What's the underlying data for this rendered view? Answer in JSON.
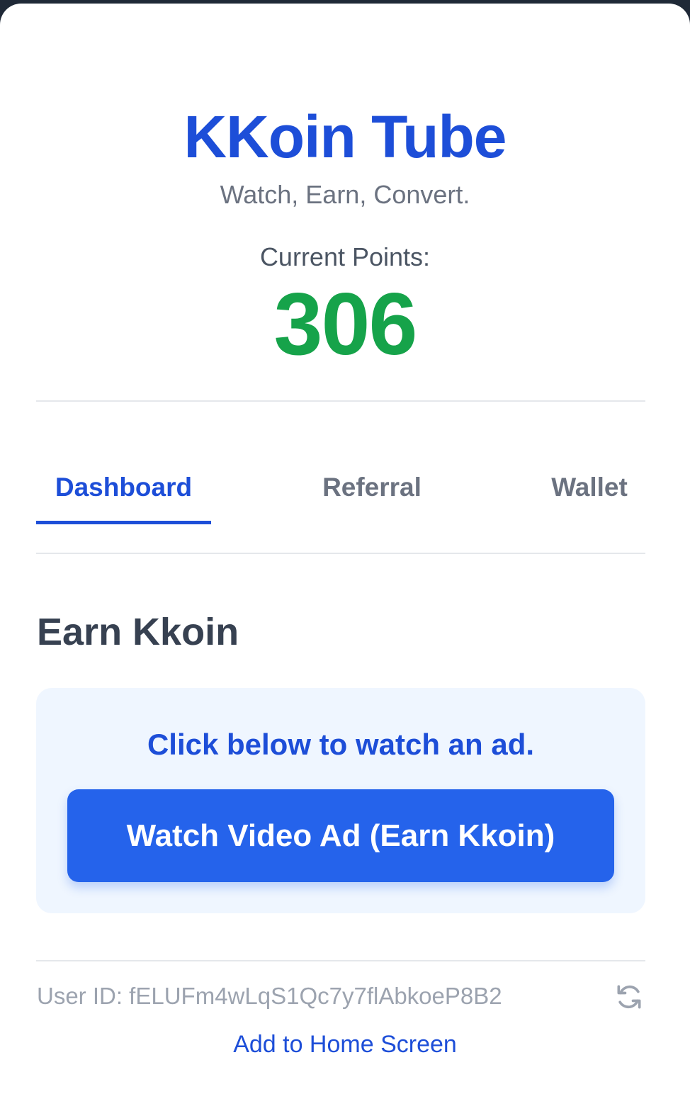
{
  "app": {
    "title": "KKoin Tube",
    "subtitle": "Watch, Earn, Convert."
  },
  "points": {
    "label": "Current Points:",
    "value": "306"
  },
  "tabs": [
    {
      "label": "Dashboard",
      "active": true
    },
    {
      "label": "Referral",
      "active": false
    },
    {
      "label": "Wallet",
      "active": false
    }
  ],
  "earn": {
    "title": "Earn Kkoin",
    "prompt": "Click below to watch an ad.",
    "button_label": "Watch Video Ad (Earn Kkoin)"
  },
  "footer": {
    "user_id": "User ID: fELUFm4wLqS1Qc7y7flAbkoeP8B2",
    "refresh_icon": "refresh-icon",
    "add_to_home_label": "Add to Home Screen"
  },
  "colors": {
    "primary": "#1d4ed8",
    "button": "#2563eb",
    "points": "#16a34a",
    "earn_box_bg": "#eff6ff"
  }
}
